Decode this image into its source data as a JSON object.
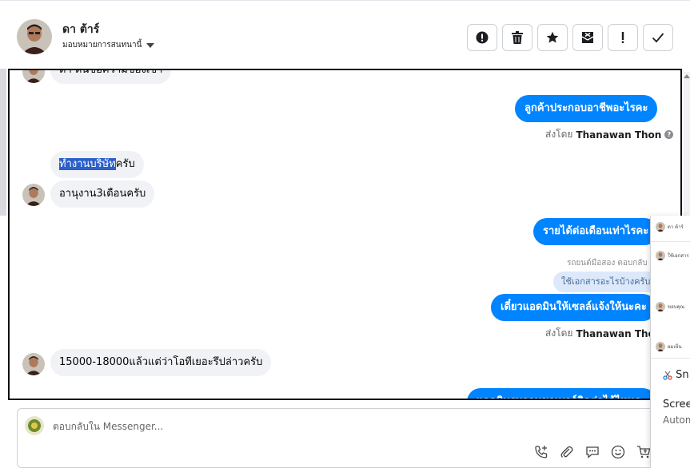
{
  "header": {
    "contact_name": "ดา ต้าร์",
    "assign_label": "มอบหมายการสนทนานี้",
    "tools": [
      {
        "name": "spam",
        "icon": "alert-circle-icon"
      },
      {
        "name": "delete",
        "icon": "trash-icon"
      },
      {
        "name": "star",
        "icon": "star-icon"
      },
      {
        "name": "mark-unread",
        "icon": "envelope-x-icon"
      },
      {
        "name": "important",
        "icon": "exclamation-icon"
      },
      {
        "name": "done",
        "icon": "check-icon"
      }
    ]
  },
  "messages": {
    "m0": "ดา ต้นข้อความของเขา",
    "m1": "ลูกค้าประกอบอาชีพอะไรคะ",
    "sent_by_prefix": "ส่งโดย",
    "agent_name": "Thanawan Thon",
    "m2_highlight": "ทำงานบริษัท",
    "m2_rest": "ครับ",
    "m3": "อานุงาน3เดือนครับ",
    "m4": "รายได้ต่อเดือนเท่าไรคะ",
    "reply_label": "ตอบกลับ",
    "reply_label_full": "รถยนต์มือสอง ตอบกลับ",
    "reply_quote": "ใช้เอกสารอะไรบ้างครับ",
    "m5": "เดี๋ยวแอดมินให้เซลล์แจ้งให้นะคะ",
    "m6": "15000-18000แล้วแต่ว่าโอทีเยอะรึปล่าวครับ",
    "m7": "แอดมินรบกวนขอเบอร์ติดต่อได้ไหมคะ"
  },
  "composer": {
    "placeholder": "ตอบกลับใน Messenger...",
    "actions": [
      "phone-add-icon",
      "attachment-icon",
      "saved-reply-icon",
      "emoji-icon",
      "cart-icon"
    ]
  },
  "overlay": {
    "rows": [
      "ดา ต้าร์",
      "ใช้เอกสาร",
      "ขอบคุณ",
      "ผมเห็น"
    ],
    "snip_label": "Sn",
    "screen_label": "Scree",
    "autom_label": "Autom"
  },
  "colors": {
    "outgoing": "#0084ff",
    "incoming": "#f0f2f5",
    "highlight": "#2b5fc9"
  }
}
